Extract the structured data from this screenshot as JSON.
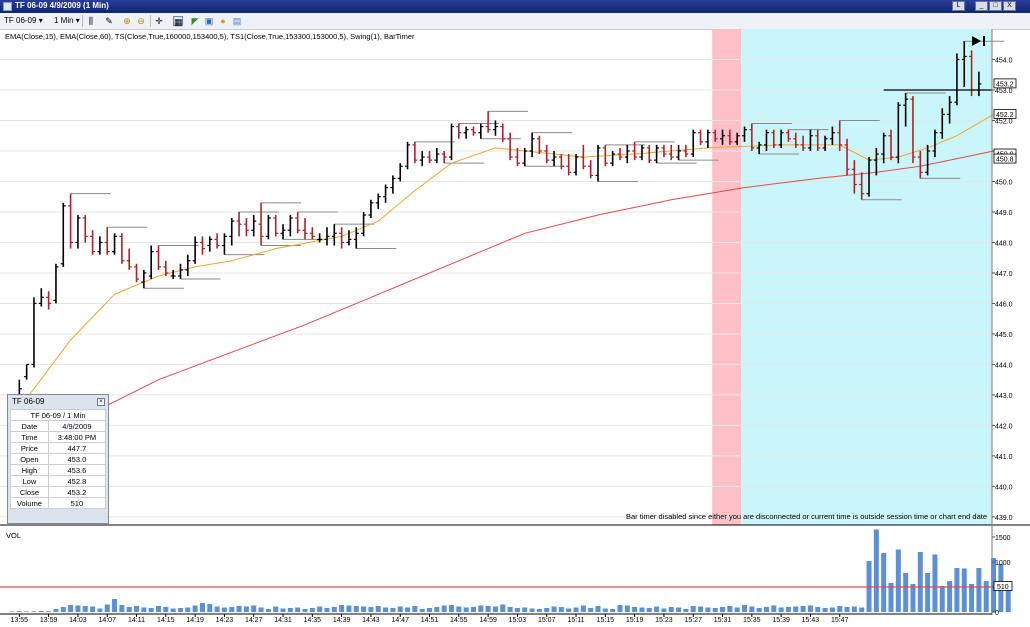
{
  "window": {
    "title": "TF 06-09  4/9/2009 (1 Min)",
    "buttons": [
      "L",
      "_",
      "□",
      "X"
    ]
  },
  "toolbar": {
    "symbol": "TF 06-09",
    "interval": "1 Min"
  },
  "chart_data": {
    "type": "ohlc",
    "indicators": "EMA(Close,15), EMA(Close,60), TS(Close,True,160000,153400,5), TS1(Close,True,153300,153000,5), Swing(1), BarTimer",
    "bar_timer_message": "Bar timer disabled since either you are disconnected or current time is outside session time or chart end date",
    "price_axis": {
      "ylim": [
        438.8,
        455.0
      ],
      "ticks": [
        "454.0",
        "453.0",
        "452.0",
        "451.0",
        "450.0",
        "449.0",
        "448.0",
        "447.0",
        "446.0",
        "445.0",
        "444.0",
        "443.0",
        "442.0",
        "441.0",
        "440.0",
        "439.0"
      ]
    },
    "price_markers": [
      {
        "label": "453.2",
        "value": 453.2
      },
      {
        "label": "452.2",
        "value": 452.2
      },
      {
        "label": "450.9",
        "value": 450.9
      },
      {
        "label": "450.8",
        "value": 450.8
      }
    ],
    "time_ticks": [
      "13:55",
      "13:59",
      "14:03",
      "14:07",
      "14:11",
      "14:15",
      "14:19",
      "14:23",
      "14:27",
      "14:31",
      "14:35",
      "14:39",
      "14:43",
      "14:47",
      "14:51",
      "14:55",
      "14:59",
      "15:03",
      "15:07",
      "15:11",
      "15:15",
      "15:19",
      "15:23",
      "15:27",
      "15:31",
      "15:35",
      "15:39",
      "15:43",
      "15:47"
    ],
    "bars": [
      [
        441.0,
        441.4,
        440.8,
        441.2
      ],
      [
        442.2,
        443.5,
        442.0,
        443.2
      ],
      [
        443.6,
        444.0,
        443.5,
        444.0
      ],
      [
        444.0,
        446.2,
        443.9,
        446.0
      ],
      [
        446.0,
        446.5,
        445.9,
        446.2
      ],
      [
        446.2,
        446.4,
        445.8,
        446.0
      ],
      [
        446.1,
        447.3,
        446.0,
        447.2
      ],
      [
        447.3,
        449.3,
        447.2,
        449.2
      ],
      [
        449.2,
        449.6,
        447.8,
        448.0
      ],
      [
        448.0,
        448.9,
        447.8,
        448.8
      ],
      [
        448.8,
        448.9,
        448.0,
        448.2
      ],
      [
        448.2,
        448.4,
        447.6,
        447.7
      ],
      [
        447.7,
        448.2,
        447.6,
        448.0
      ],
      [
        448.0,
        448.5,
        447.6,
        447.7
      ],
      [
        447.7,
        448.3,
        447.6,
        448.2
      ],
      [
        448.2,
        448.3,
        447.3,
        447.4
      ],
      [
        447.4,
        447.8,
        447.1,
        447.2
      ],
      [
        447.2,
        447.3,
        446.7,
        446.8
      ],
      [
        446.7,
        447.1,
        446.5,
        447.0
      ],
      [
        446.9,
        447.9,
        446.8,
        447.7
      ],
      [
        447.7,
        447.9,
        447.1,
        447.2
      ],
      [
        447.2,
        447.4,
        446.9,
        447.0
      ],
      [
        446.9,
        447.1,
        446.8,
        446.9
      ],
      [
        446.9,
        447.3,
        446.8,
        447.1
      ],
      [
        447.1,
        447.6,
        446.9,
        447.4
      ],
      [
        447.4,
        448.2,
        447.3,
        448.0
      ],
      [
        448.0,
        448.2,
        447.6,
        447.8
      ],
      [
        447.9,
        448.2,
        447.7,
        448.1
      ],
      [
        448.1,
        448.3,
        447.8,
        447.9
      ],
      [
        447.9,
        448.3,
        447.6,
        448.2
      ],
      [
        448.2,
        448.8,
        447.9,
        448.7
      ],
      [
        448.7,
        449.0,
        448.2,
        448.6
      ],
      [
        448.6,
        448.8,
        448.2,
        448.4
      ],
      [
        448.4,
        448.9,
        448.2,
        448.7
      ],
      [
        448.6,
        449.3,
        447.9,
        448.2
      ],
      [
        448.2,
        448.9,
        448.1,
        448.8
      ],
      [
        448.8,
        448.9,
        448.2,
        448.3
      ],
      [
        448.3,
        448.6,
        448.1,
        448.4
      ],
      [
        448.4,
        448.9,
        448.2,
        448.8
      ],
      [
        448.8,
        449.0,
        448.3,
        448.4
      ],
      [
        448.4,
        448.8,
        448.1,
        448.3
      ],
      [
        448.3,
        448.5,
        448.1,
        448.2
      ],
      [
        448.1,
        448.3,
        448.0,
        448.1
      ],
      [
        448.1,
        448.5,
        447.9,
        448.2
      ],
      [
        448.2,
        448.6,
        447.9,
        448.3
      ],
      [
        448.3,
        448.5,
        447.8,
        448.0
      ],
      [
        448.0,
        448.4,
        447.9,
        448.1
      ],
      [
        448.1,
        448.5,
        447.8,
        448.3
      ],
      [
        448.3,
        449.0,
        448.2,
        448.9
      ],
      [
        448.9,
        449.4,
        448.8,
        449.3
      ],
      [
        449.3,
        449.6,
        449.1,
        449.5
      ],
      [
        449.5,
        449.9,
        449.3,
        449.8
      ],
      [
        449.8,
        450.2,
        449.6,
        450.1
      ],
      [
        450.1,
        450.6,
        450.0,
        450.5
      ],
      [
        450.5,
        451.3,
        450.4,
        451.2
      ],
      [
        451.2,
        451.3,
        450.6,
        450.7
      ],
      [
        450.7,
        451.0,
        450.5,
        450.8
      ],
      [
        450.8,
        451.0,
        450.6,
        450.7
      ],
      [
        450.7,
        451.1,
        450.6,
        450.9
      ],
      [
        450.9,
        451.0,
        450.6,
        450.8
      ],
      [
        450.8,
        451.9,
        450.7,
        451.8
      ],
      [
        451.8,
        451.9,
        451.4,
        451.6
      ],
      [
        451.6,
        451.8,
        451.4,
        451.7
      ],
      [
        451.7,
        451.8,
        451.5,
        451.6
      ],
      [
        451.6,
        451.9,
        451.4,
        451.8
      ],
      [
        451.8,
        452.3,
        451.6,
        451.7
      ],
      [
        451.7,
        452.0,
        451.5,
        451.8
      ],
      [
        451.8,
        451.9,
        451.3,
        451.4
      ],
      [
        451.4,
        451.6,
        450.7,
        450.8
      ],
      [
        450.8,
        451.1,
        450.5,
        450.6
      ],
      [
        450.6,
        451.1,
        450.5,
        451.0
      ],
      [
        451.0,
        451.6,
        450.8,
        451.4
      ],
      [
        451.4,
        451.5,
        450.9,
        451.0
      ],
      [
        451.0,
        451.2,
        450.6,
        450.7
      ],
      [
        450.7,
        451.0,
        450.5,
        450.8
      ],
      [
        450.8,
        450.9,
        450.4,
        450.5
      ],
      [
        450.5,
        450.9,
        450.2,
        450.3
      ],
      [
        450.3,
        450.9,
        450.2,
        450.8
      ],
      [
        450.8,
        451.2,
        450.4,
        450.5
      ],
      [
        450.5,
        450.7,
        450.1,
        450.2
      ],
      [
        450.2,
        451.2,
        450.0,
        451.1
      ],
      [
        451.1,
        451.2,
        450.5,
        450.6
      ],
      [
        450.6,
        451.0,
        450.5,
        450.9
      ],
      [
        450.9,
        451.1,
        450.7,
        450.8
      ],
      [
        450.8,
        451.2,
        450.6,
        451.0
      ],
      [
        451.0,
        451.3,
        450.7,
        450.8
      ],
      [
        450.8,
        451.2,
        450.7,
        451.1
      ],
      [
        451.1,
        451.2,
        450.6,
        450.7
      ],
      [
        450.7,
        451.2,
        450.6,
        451.1
      ],
      [
        451.1,
        451.2,
        450.8,
        450.9
      ],
      [
        450.9,
        451.2,
        450.7,
        450.8
      ],
      [
        450.8,
        451.2,
        450.7,
        451.0
      ],
      [
        451.0,
        451.2,
        450.8,
        450.9
      ],
      [
        450.9,
        451.7,
        450.8,
        451.6
      ],
      [
        451.6,
        451.7,
        451.2,
        451.3
      ],
      [
        451.3,
        451.7,
        451.1,
        451.6
      ],
      [
        451.6,
        451.7,
        451.3,
        451.4
      ],
      [
        451.4,
        451.7,
        451.2,
        451.5
      ],
      [
        451.5,
        451.7,
        451.2,
        451.3
      ],
      [
        451.3,
        451.6,
        451.2,
        451.5
      ],
      [
        451.5,
        451.8,
        451.3,
        451.7
      ],
      [
        451.7,
        451.9,
        451.0,
        451.1
      ],
      [
        451.1,
        451.3,
        450.9,
        451.2
      ],
      [
        451.2,
        451.7,
        451.0,
        451.6
      ],
      [
        451.6,
        451.7,
        451.1,
        451.2
      ],
      [
        451.2,
        451.7,
        451.1,
        451.6
      ],
      [
        451.6,
        451.7,
        451.3,
        451.4
      ],
      [
        451.4,
        451.6,
        451.1,
        451.2
      ],
      [
        451.2,
        451.5,
        451.0,
        451.1
      ],
      [
        451.1,
        451.7,
        451.0,
        451.5
      ],
      [
        451.5,
        451.7,
        451.0,
        451.1
      ],
      [
        451.1,
        451.5,
        451.0,
        451.4
      ],
      [
        451.4,
        451.8,
        451.2,
        451.6
      ],
      [
        451.6,
        452.0,
        451.0,
        451.2
      ],
      [
        451.2,
        451.4,
        450.2,
        450.4
      ],
      [
        450.4,
        450.7,
        449.6,
        449.9
      ],
      [
        449.9,
        450.3,
        449.4,
        449.6
      ],
      [
        449.6,
        450.8,
        449.5,
        450.7
      ],
      [
        450.7,
        451.1,
        450.2,
        450.9
      ],
      [
        450.9,
        451.6,
        450.6,
        451.5
      ],
      [
        451.5,
        451.7,
        450.7,
        450.8
      ],
      [
        450.8,
        452.6,
        450.6,
        452.5
      ],
      [
        452.5,
        452.9,
        451.8,
        452.7
      ],
      [
        452.7,
        452.8,
        450.6,
        450.8
      ],
      [
        450.8,
        451.0,
        450.1,
        450.3
      ],
      [
        450.3,
        451.2,
        450.2,
        451.0
      ],
      [
        451.0,
        451.7,
        450.8,
        451.6
      ],
      [
        451.6,
        452.4,
        451.4,
        452.2
      ],
      [
        452.2,
        452.8,
        451.9,
        452.6
      ],
      [
        452.6,
        454.2,
        452.5,
        454.0
      ],
      [
        454.0,
        454.6,
        453.1,
        454.1
      ],
      [
        454.1,
        454.3,
        452.8,
        453.0
      ],
      [
        453.0,
        453.6,
        452.8,
        453.2
      ]
    ],
    "ema_fast": [
      [
        0,
        442.3
      ],
      [
        3,
        443.2
      ],
      [
        8,
        444.8
      ],
      [
        14,
        446.3
      ],
      [
        20,
        446.9
      ],
      [
        25,
        447.2
      ],
      [
        30,
        447.4
      ],
      [
        36,
        447.8
      ],
      [
        45,
        448.2
      ],
      [
        50,
        448.7
      ],
      [
        55,
        449.7
      ],
      [
        60,
        450.6
      ],
      [
        66,
        451.1
      ],
      [
        70,
        451.0
      ],
      [
        78,
        450.8
      ],
      [
        85,
        450.9
      ],
      [
        95,
        451.1
      ],
      [
        105,
        451.2
      ],
      [
        113,
        451.2
      ],
      [
        117,
        450.7
      ],
      [
        121,
        450.8
      ],
      [
        125,
        451.1
      ],
      [
        129,
        451.5
      ],
      [
        134,
        452.2
      ]
    ],
    "ema_slow": [
      [
        1,
        441.0
      ],
      [
        10,
        442.3
      ],
      [
        20,
        443.5
      ],
      [
        30,
        444.4
      ],
      [
        40,
        445.3
      ],
      [
        50,
        446.3
      ],
      [
        60,
        447.3
      ],
      [
        70,
        448.3
      ],
      [
        80,
        448.9
      ],
      [
        90,
        449.4
      ],
      [
        100,
        449.8
      ],
      [
        110,
        450.1
      ],
      [
        118,
        450.3
      ],
      [
        124,
        450.5
      ],
      [
        130,
        450.8
      ],
      [
        134,
        451.0
      ]
    ],
    "session_zones": [
      {
        "name": "TS1",
        "color": "#ffc0c8",
        "start": "15:30",
        "end": "15:33"
      },
      {
        "name": "TS",
        "color": "#c9f6fb",
        "start": "15:34",
        "end": "16:00"
      }
    ],
    "volume": {
      "label": "VOL",
      "ticks": [
        "1500",
        "1000",
        "500",
        "0"
      ],
      "ylim": [
        0,
        1700
      ],
      "last_value_label": "510",
      "reference_level": 500,
      "values": [
        10,
        18,
        12,
        14,
        20,
        16,
        60,
        100,
        140,
        130,
        120,
        110,
        70,
        150,
        260,
        140,
        100,
        120,
        90,
        80,
        120,
        100,
        70,
        80,
        90,
        130,
        180,
        160,
        110,
        90,
        100,
        120,
        110,
        130,
        90,
        60,
        110,
        70,
        80,
        90,
        60,
        80,
        110,
        80,
        100,
        140,
        130,
        120,
        110,
        100,
        120,
        90,
        80,
        110,
        90,
        120,
        60,
        80,
        100,
        130,
        140,
        110,
        90,
        100,
        130,
        120,
        110,
        150,
        100,
        80,
        90,
        70,
        60,
        80,
        110,
        100,
        70,
        90,
        130,
        80,
        120,
        70,
        60,
        140,
        130,
        100,
        90,
        80,
        110,
        70,
        100,
        90,
        60,
        120,
        110,
        90,
        80,
        100,
        120,
        90,
        140,
        110,
        80,
        100,
        130,
        90,
        100,
        110,
        120,
        130,
        100,
        80,
        90,
        120,
        100,
        110,
        90,
        1020,
        1650,
        1180,
        580,
        1250,
        780,
        560,
        1200,
        780,
        1150,
        520,
        620,
        880,
        870,
        560,
        880,
        620,
        1080,
        960,
        510
      ]
    }
  },
  "data_window": {
    "title": "TF 06-09",
    "header": "TF 06-09 / 1 Min",
    "rows": [
      {
        "label": "Date",
        "value": "4/9/2009"
      },
      {
        "label": "Time",
        "value": "3:48:00 PM"
      },
      {
        "label": "Price",
        "value": "447.7"
      },
      {
        "label": "Open",
        "value": "453.0"
      },
      {
        "label": "High",
        "value": "453.6"
      },
      {
        "label": "Low",
        "value": "452.8"
      },
      {
        "label": "Close",
        "value": "453.2"
      },
      {
        "label": "Volume",
        "value": "510"
      }
    ]
  }
}
